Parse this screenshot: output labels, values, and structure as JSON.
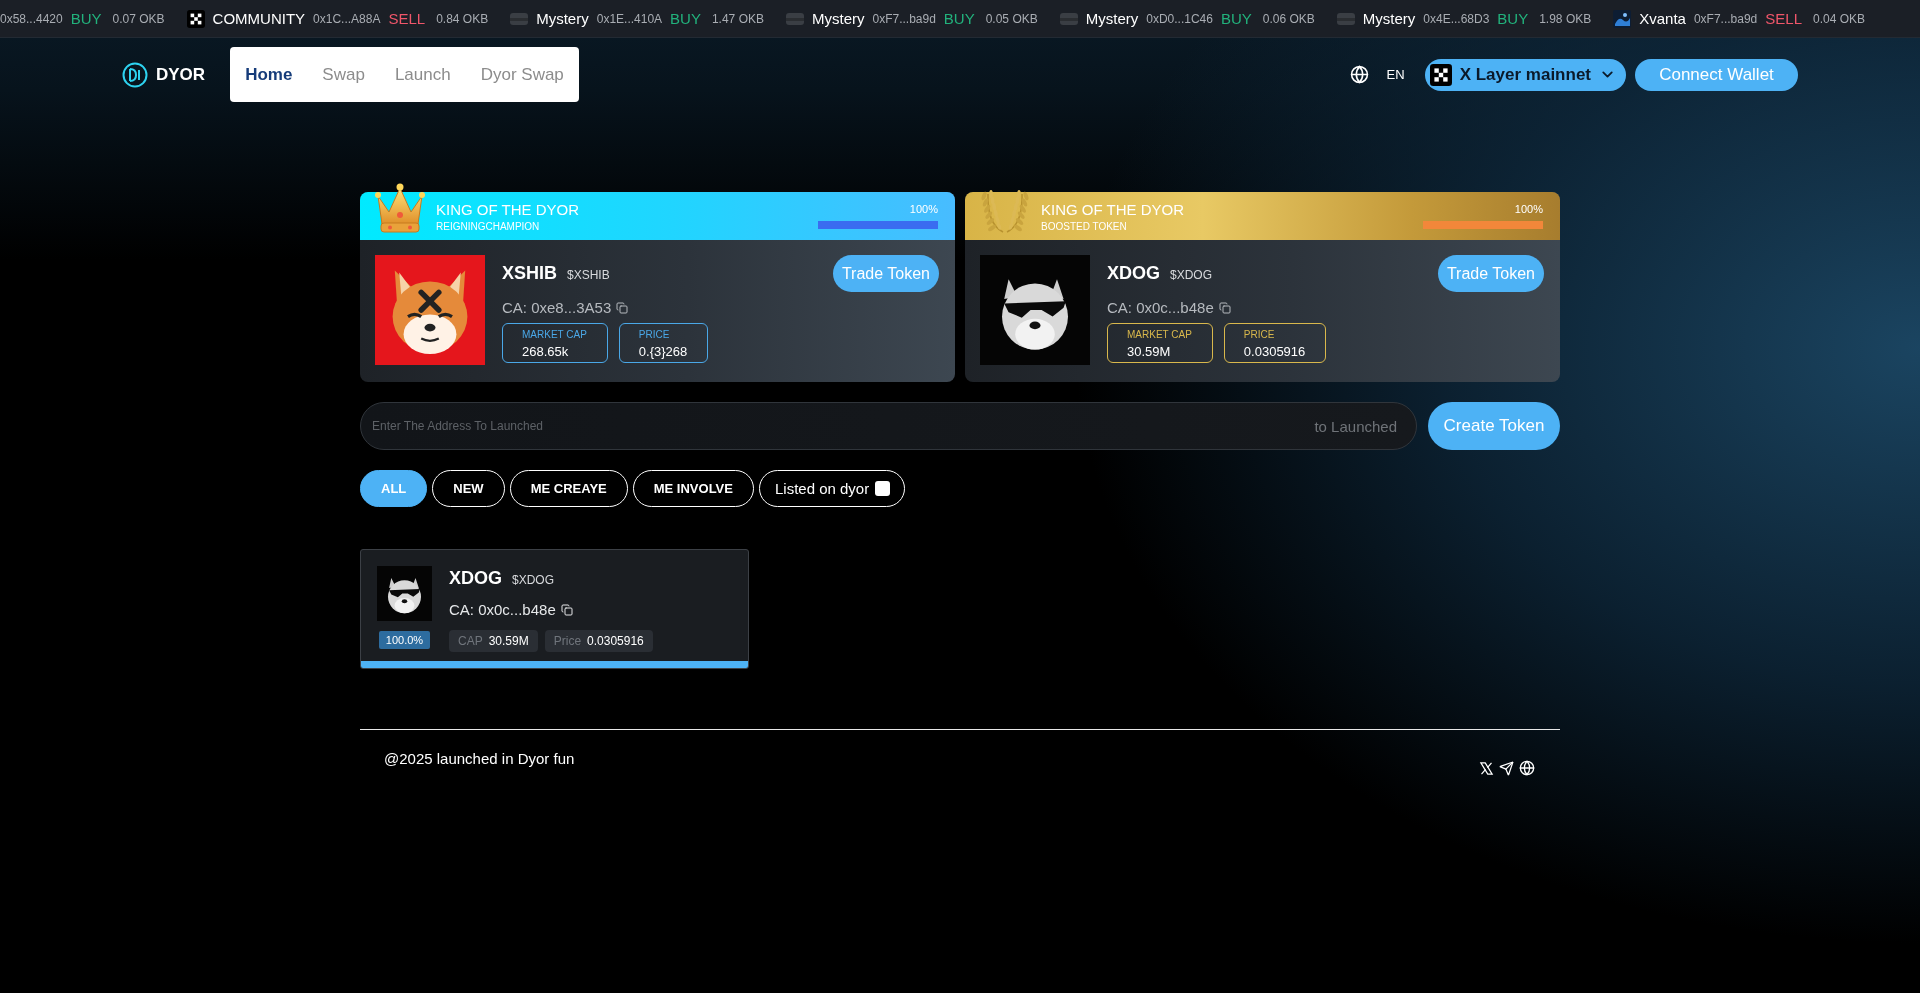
{
  "ticker": [
    {
      "kind": "bare",
      "address": "0x58...4420",
      "action": "BUY",
      "color": "#22b27c",
      "amount": "0.07 OKB"
    },
    {
      "kind": "logo",
      "name": "COMMUNITY",
      "address": "0x1C...A88A",
      "action": "SELL",
      "color": "#f0566a",
      "amount": "0.84 OKB"
    },
    {
      "kind": "blank",
      "name": "Mystery",
      "address": "0x1E...410A",
      "action": "BUY",
      "color": "#22b27c",
      "amount": "1.47 OKB"
    },
    {
      "kind": "blank",
      "name": "Mystery",
      "address": "0xF7...ba9d",
      "action": "BUY",
      "color": "#22b27c",
      "amount": "0.05 OKB"
    },
    {
      "kind": "blank",
      "name": "Mystery",
      "address": "0xD0...1C46",
      "action": "BUY",
      "color": "#22b27c",
      "amount": "0.06 OKB"
    },
    {
      "kind": "blank",
      "name": "Mystery",
      "address": "0x4E...68D3",
      "action": "BUY",
      "color": "#22b27c",
      "amount": "1.98 OKB"
    },
    {
      "kind": "photo",
      "name": "Xvanta",
      "address": "0xF7...ba9d",
      "action": "SELL",
      "color": "#f0566a",
      "amount": "0.04 OKB"
    }
  ],
  "nav": {
    "logo": "DYOR",
    "items": [
      {
        "label": "Home",
        "selected": true
      },
      {
        "label": "Swap",
        "selected": false
      },
      {
        "label": "Launch",
        "selected": false
      },
      {
        "label": "Dyor Swap",
        "selected": false
      }
    ],
    "language": "EN",
    "network": "X Layer mainnet",
    "connect": "Connect Wallet"
  },
  "kings": [
    {
      "kind": "champion",
      "title": "KING OF THE DYOR",
      "subtitle": "REIGNINGCHAMPION",
      "percent": "100%",
      "level": 1,
      "name": "XSHIB",
      "symbol": "$XSHIB",
      "ca": "CA: 0xe8...3A53",
      "trade": "Trade Token",
      "stats": [
        {
          "label": "MARKET CAP",
          "value": "268.65k"
        },
        {
          "label": "PRICE",
          "value": "0.{3}268"
        }
      ]
    },
    {
      "kind": "boosted",
      "title": "KING OF THE DYOR",
      "subtitle": "BOOSTED TOKEN",
      "percent": "100%",
      "level": 1,
      "name": "XDOG",
      "symbol": "$XDOG",
      "ca": "CA: 0x0c...b48e",
      "trade": "Trade Token",
      "stats": [
        {
          "label": "MARKET CAP",
          "value": "30.59M"
        },
        {
          "label": "PRICE",
          "value": "0.0305916"
        }
      ]
    }
  ],
  "launch": {
    "placeholder": "Enter The Address To Launched",
    "suffix": "to Launched",
    "button": "Create Token"
  },
  "filters": [
    {
      "label": "ALL",
      "selected": true
    },
    {
      "label": "NEW",
      "selected": false
    },
    {
      "label": "ME CREAYE",
      "selected": false
    },
    {
      "label": "ME INVOLVE",
      "selected": false
    }
  ],
  "listed": {
    "label": "Listed on dyor",
    "checked": false
  },
  "tokens": [
    {
      "name": "XDOG",
      "symbol": "$XDOG",
      "ca": "CA: 0x0c...b48e",
      "progress": "100.0%",
      "level": 1,
      "cap_label": "CAP",
      "cap": "30.59M",
      "price_label": "Price",
      "price": "0.0305916"
    }
  ],
  "footer": {
    "copyright": "@2025 launched in Dyor fun"
  }
}
